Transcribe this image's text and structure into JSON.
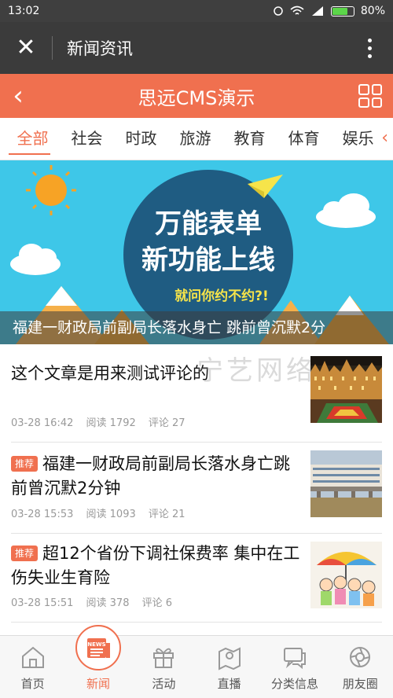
{
  "status": {
    "time": "13:02",
    "battery": "80%",
    "battery_level": 0.8
  },
  "appbar": {
    "title": "新闻资讯"
  },
  "sitebar": {
    "title": "思远CMS演示"
  },
  "tabs": [
    {
      "label": "全部",
      "active": true
    },
    {
      "label": "社会"
    },
    {
      "label": "时政"
    },
    {
      "label": "旅游"
    },
    {
      "label": "教育"
    },
    {
      "label": "体育"
    },
    {
      "label": "娱乐"
    }
  ],
  "banner": {
    "headline1": "万能表单",
    "headline2": "新功能上线",
    "sub": "就问你约不约?!",
    "caption": "福建一财政局前副局长落水身亡 跳前曾沉默2分"
  },
  "watermark": "宁艺网络",
  "news": [
    {
      "title": "这个文章是用来测试评论的",
      "tag": "",
      "date": "03-28 16:42",
      "reads": "阅读 1792",
      "comments": "评论 27"
    },
    {
      "title": "福建一财政局前副局长落水身亡跳前曾沉默2分钟",
      "tag": "推荐",
      "date": "03-28 15:53",
      "reads": "阅读 1093",
      "comments": "评论 21"
    },
    {
      "title": "超12个省份下调社保费率 集中在工伤失业生育险",
      "tag": "推荐",
      "date": "03-28 15:51",
      "reads": "阅读 378",
      "comments": "评论 6"
    }
  ],
  "bottomnav": [
    {
      "label": "首页",
      "icon": "home-icon"
    },
    {
      "label": "新闻",
      "icon": "news-icon",
      "active": true
    },
    {
      "label": "活动",
      "icon": "gift-icon"
    },
    {
      "label": "直播",
      "icon": "map-pin-icon"
    },
    {
      "label": "分类信息",
      "icon": "chat-icon"
    },
    {
      "label": "朋友圈",
      "icon": "camera-aperture-icon"
    }
  ],
  "colors": {
    "accent": "#f0704f",
    "appbar": "#3b3b3b",
    "banner_bg": "#3ec7e8"
  }
}
